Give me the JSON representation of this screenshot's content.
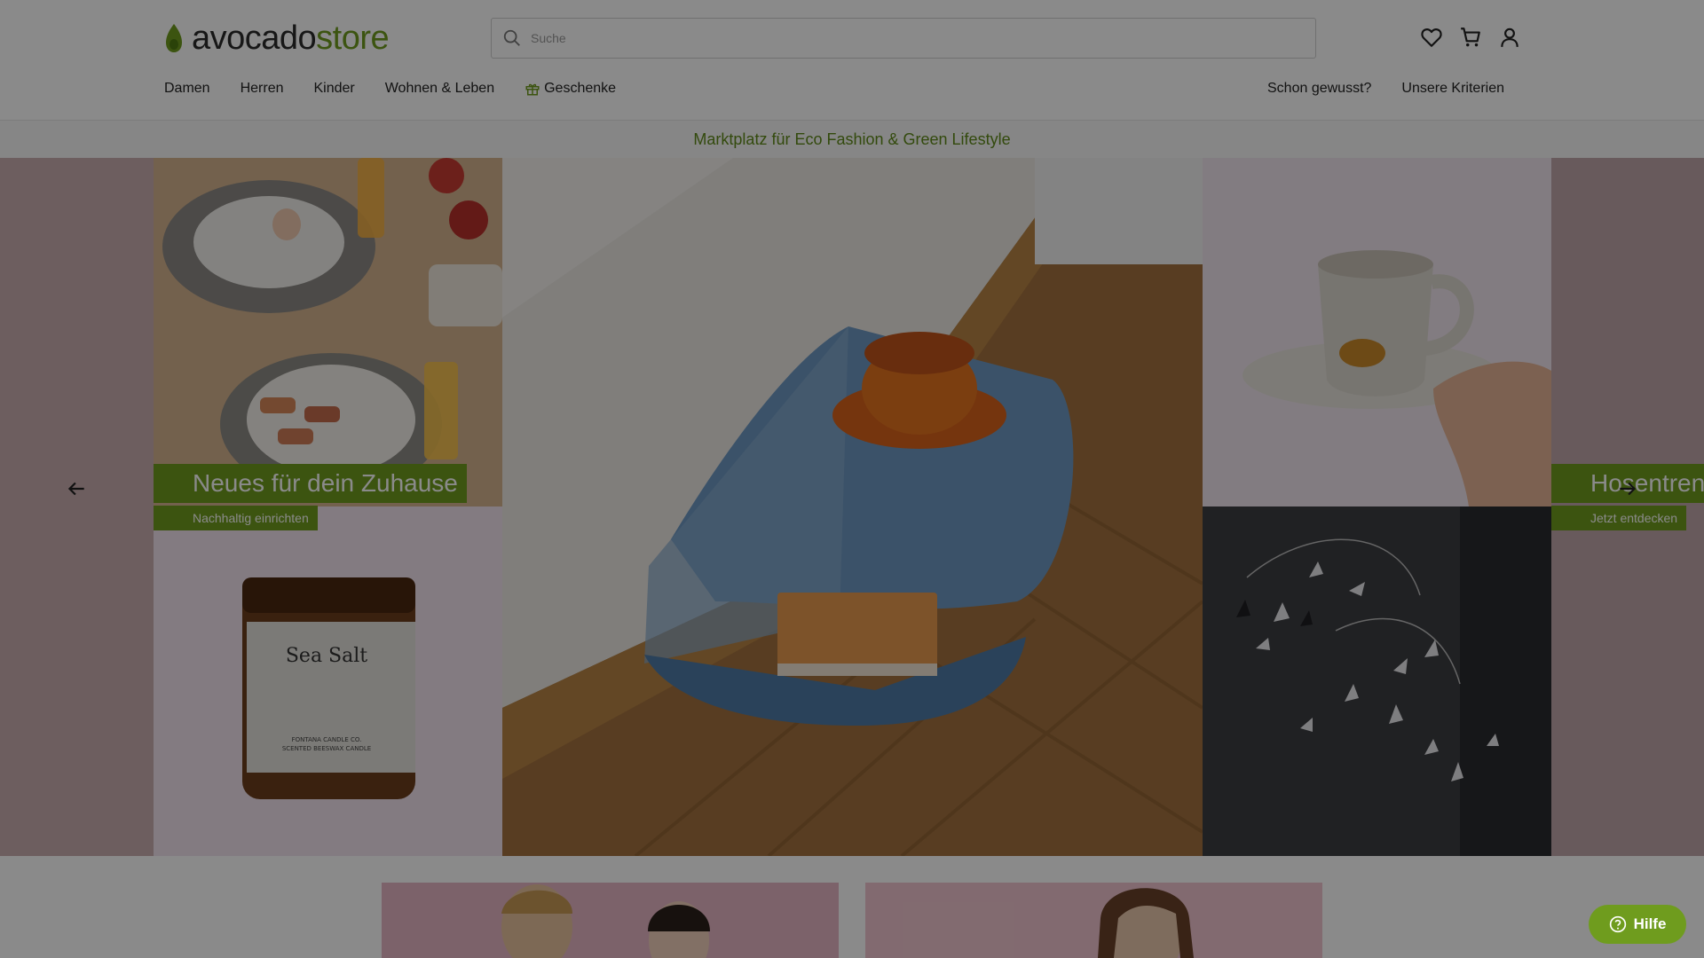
{
  "header": {
    "logo": {
      "part1": "avocado",
      "part2": "store"
    },
    "search": {
      "placeholder": "Suche"
    },
    "icons": [
      "heart-icon",
      "cart-icon",
      "user-icon"
    ]
  },
  "nav": {
    "items": [
      {
        "label": "Damen"
      },
      {
        "label": "Herren"
      },
      {
        "label": "Kinder"
      },
      {
        "label": "Wohnen & Leben"
      },
      {
        "label": "Geschenke",
        "icon": "gift-icon"
      }
    ],
    "right": [
      {
        "label": "Schon gewusst?"
      },
      {
        "label": "Unsere Kriterien"
      }
    ]
  },
  "tagline": "Marktplatz für Eco Fashion & Green Lifestyle",
  "hero": {
    "left_tile": {
      "title": "Neues für dein Zuhause",
      "subtitle": "Nachhaltig einrichten"
    },
    "right_tile": {
      "title": "Hosentrends",
      "subtitle": "Jetzt entdecken"
    },
    "candle": {
      "name": "Sea Salt",
      "brand": "FONTANA CANDLE CO.",
      "desc": "SCENTED BEESWAX CANDLE"
    }
  },
  "help": {
    "label": "Hilfe"
  },
  "colors": {
    "brand_green": "#6f9c1e",
    "overlay": "rgba(0,0,0,0.46)"
  }
}
